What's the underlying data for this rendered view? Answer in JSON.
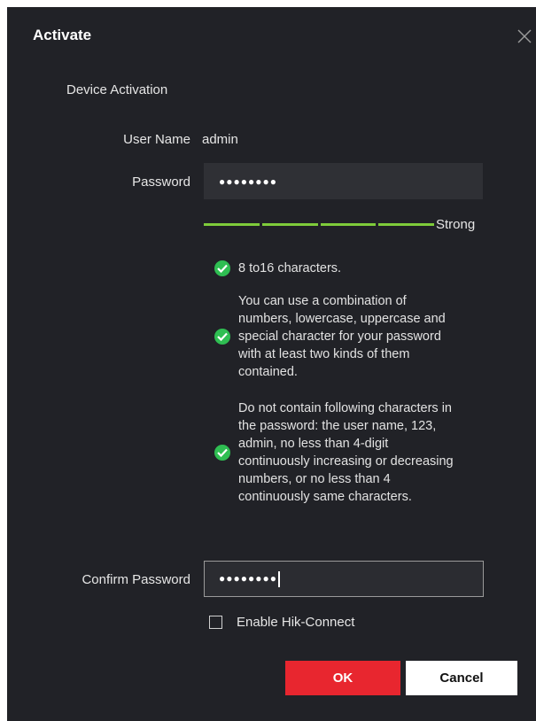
{
  "dialog": {
    "title": "Activate",
    "section_title": "Device Activation"
  },
  "form": {
    "username_label": "User Name",
    "username_value": "admin",
    "password_label": "Password",
    "password_masked": "●●●●●●●●",
    "strength_text": "Strong",
    "strength_level": 1.0,
    "confirm_label": "Confirm Password",
    "confirm_masked": "●●●●●●●●"
  },
  "rules": [
    {
      "text": "8 to16 characters.",
      "satisfied": true
    },
    {
      "text": "You can use a combination of numbers, lowercase, uppercase and special character for your password with at least two kinds of them contained.",
      "satisfied": true
    },
    {
      "text": "Do not contain following characters in the password: the user name, 123, admin, no less than 4-digit continuously increasing or decreasing numbers, or no less than 4 continuously same characters.",
      "satisfied": true
    }
  ],
  "options": {
    "hik_connect_label": "Enable Hik-Connect",
    "hik_connect_checked": false
  },
  "buttons": {
    "ok": "OK",
    "cancel": "Cancel"
  },
  "colors": {
    "background": "#212227",
    "accent_red": "#e8262f",
    "strength_green": "#7fcc3a",
    "check_green": "#2fbe52"
  },
  "icons": {
    "close": "close-icon",
    "check": "check-circle-icon"
  }
}
